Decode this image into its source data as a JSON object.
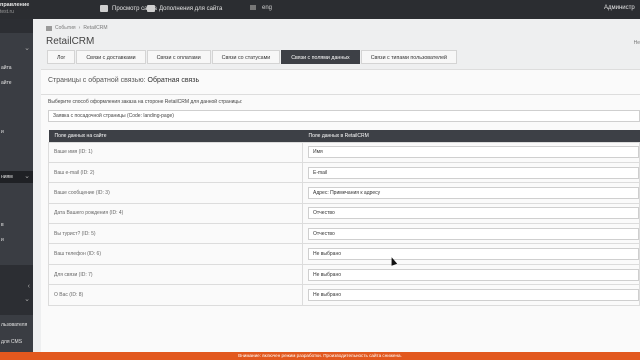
{
  "topbar": {
    "logo_title": "правление",
    "logo_sub": "test.ru",
    "view_site": "Просмотр сайта",
    "addons": "Дополнения для сайта",
    "lang": "eng",
    "admin": "Администр"
  },
  "sidebar": {
    "items": [
      {
        "label": "",
        "arrow": "⌄"
      },
      {
        "label": "айта"
      },
      {
        "label": "айте"
      },
      {
        "label": "и"
      },
      {
        "label": "ниям",
        "arrow": "⌄"
      },
      {
        "label": "в"
      },
      {
        "label": "и"
      },
      {
        "label": "",
        "arrow": "‹"
      },
      {
        "label": "",
        "arrow": "⌄"
      },
      {
        "label": "льзователя"
      },
      {
        "label": "для CMS"
      }
    ]
  },
  "breadcrumb": {
    "parent": "События",
    "current": "RetailCRM"
  },
  "page_title": "RetailCRM",
  "help_label": "Не",
  "tabs": [
    {
      "label": "Лог",
      "active": false
    },
    {
      "label": "Связи с доставками",
      "active": false
    },
    {
      "label": "Связи с оплатами",
      "active": false
    },
    {
      "label": "Связи со статусами",
      "active": false
    },
    {
      "label": "Связи с полями данных",
      "active": true
    },
    {
      "label": "Связи с типами пользователей",
      "active": false
    }
  ],
  "section": {
    "prefix": "Страницы с обратной связью:",
    "name": "Обратная связь"
  },
  "select_label": "Выберите способ оформления заказа на стороне RetailCRM для данной страницы:",
  "select_value": "Заявка с посадочной страницы (Code: landing-page)",
  "table": {
    "col1": "Поле данных на сайте",
    "col2": "Поле данных в RetailCRM",
    "rows": [
      {
        "site": "Ваше имя (ID: 1)",
        "crm": "Имя"
      },
      {
        "site": "Ваш e-mail (ID: 2)",
        "crm": "E-mail"
      },
      {
        "site": "Ваше сообщение (ID: 3)",
        "crm": "Адрес: Примечания к адресу"
      },
      {
        "site": "Дата Вашего рождения (ID: 4)",
        "crm": "Отчество"
      },
      {
        "site": "Вы турист? (ID: 5)",
        "crm": "Отчество"
      },
      {
        "site": "Ваш телефон (ID: 6)",
        "crm": "Не выбрано"
      },
      {
        "site": "Для связи (ID: 7)",
        "crm": "Не выбрано"
      },
      {
        "site": "О Вас (ID: 8)",
        "crm": "Не выбрано"
      }
    ]
  },
  "footer": "Внимание: включен режим разработки. Производительность сайта снижена."
}
